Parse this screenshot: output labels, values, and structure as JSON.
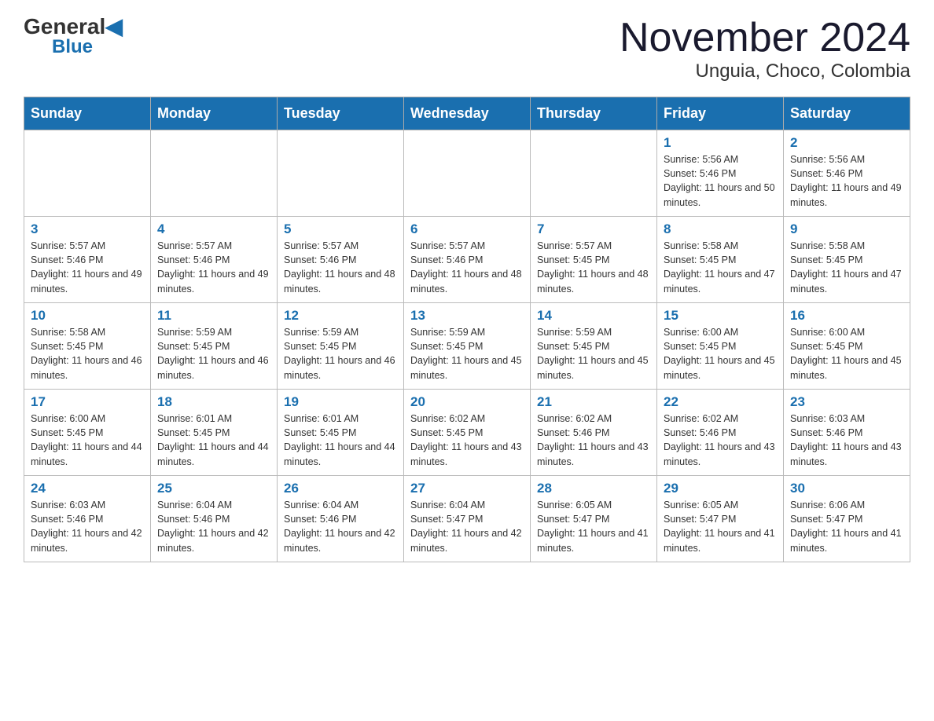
{
  "header": {
    "logo_general": "General",
    "logo_blue": "Blue",
    "month_title": "November 2024",
    "location": "Unguia, Choco, Colombia"
  },
  "weekdays": [
    "Sunday",
    "Monday",
    "Tuesday",
    "Wednesday",
    "Thursday",
    "Friday",
    "Saturday"
  ],
  "weeks": [
    [
      {
        "day": "",
        "sunrise": "",
        "sunset": "",
        "daylight": ""
      },
      {
        "day": "",
        "sunrise": "",
        "sunset": "",
        "daylight": ""
      },
      {
        "day": "",
        "sunrise": "",
        "sunset": "",
        "daylight": ""
      },
      {
        "day": "",
        "sunrise": "",
        "sunset": "",
        "daylight": ""
      },
      {
        "day": "",
        "sunrise": "",
        "sunset": "",
        "daylight": ""
      },
      {
        "day": "1",
        "sunrise": "Sunrise: 5:56 AM",
        "sunset": "Sunset: 5:46 PM",
        "daylight": "Daylight: 11 hours and 50 minutes."
      },
      {
        "day": "2",
        "sunrise": "Sunrise: 5:56 AM",
        "sunset": "Sunset: 5:46 PM",
        "daylight": "Daylight: 11 hours and 49 minutes."
      }
    ],
    [
      {
        "day": "3",
        "sunrise": "Sunrise: 5:57 AM",
        "sunset": "Sunset: 5:46 PM",
        "daylight": "Daylight: 11 hours and 49 minutes."
      },
      {
        "day": "4",
        "sunrise": "Sunrise: 5:57 AM",
        "sunset": "Sunset: 5:46 PM",
        "daylight": "Daylight: 11 hours and 49 minutes."
      },
      {
        "day": "5",
        "sunrise": "Sunrise: 5:57 AM",
        "sunset": "Sunset: 5:46 PM",
        "daylight": "Daylight: 11 hours and 48 minutes."
      },
      {
        "day": "6",
        "sunrise": "Sunrise: 5:57 AM",
        "sunset": "Sunset: 5:46 PM",
        "daylight": "Daylight: 11 hours and 48 minutes."
      },
      {
        "day": "7",
        "sunrise": "Sunrise: 5:57 AM",
        "sunset": "Sunset: 5:45 PM",
        "daylight": "Daylight: 11 hours and 48 minutes."
      },
      {
        "day": "8",
        "sunrise": "Sunrise: 5:58 AM",
        "sunset": "Sunset: 5:45 PM",
        "daylight": "Daylight: 11 hours and 47 minutes."
      },
      {
        "day": "9",
        "sunrise": "Sunrise: 5:58 AM",
        "sunset": "Sunset: 5:45 PM",
        "daylight": "Daylight: 11 hours and 47 minutes."
      }
    ],
    [
      {
        "day": "10",
        "sunrise": "Sunrise: 5:58 AM",
        "sunset": "Sunset: 5:45 PM",
        "daylight": "Daylight: 11 hours and 46 minutes."
      },
      {
        "day": "11",
        "sunrise": "Sunrise: 5:59 AM",
        "sunset": "Sunset: 5:45 PM",
        "daylight": "Daylight: 11 hours and 46 minutes."
      },
      {
        "day": "12",
        "sunrise": "Sunrise: 5:59 AM",
        "sunset": "Sunset: 5:45 PM",
        "daylight": "Daylight: 11 hours and 46 minutes."
      },
      {
        "day": "13",
        "sunrise": "Sunrise: 5:59 AM",
        "sunset": "Sunset: 5:45 PM",
        "daylight": "Daylight: 11 hours and 45 minutes."
      },
      {
        "day": "14",
        "sunrise": "Sunrise: 5:59 AM",
        "sunset": "Sunset: 5:45 PM",
        "daylight": "Daylight: 11 hours and 45 minutes."
      },
      {
        "day": "15",
        "sunrise": "Sunrise: 6:00 AM",
        "sunset": "Sunset: 5:45 PM",
        "daylight": "Daylight: 11 hours and 45 minutes."
      },
      {
        "day": "16",
        "sunrise": "Sunrise: 6:00 AM",
        "sunset": "Sunset: 5:45 PM",
        "daylight": "Daylight: 11 hours and 45 minutes."
      }
    ],
    [
      {
        "day": "17",
        "sunrise": "Sunrise: 6:00 AM",
        "sunset": "Sunset: 5:45 PM",
        "daylight": "Daylight: 11 hours and 44 minutes."
      },
      {
        "day": "18",
        "sunrise": "Sunrise: 6:01 AM",
        "sunset": "Sunset: 5:45 PM",
        "daylight": "Daylight: 11 hours and 44 minutes."
      },
      {
        "day": "19",
        "sunrise": "Sunrise: 6:01 AM",
        "sunset": "Sunset: 5:45 PM",
        "daylight": "Daylight: 11 hours and 44 minutes."
      },
      {
        "day": "20",
        "sunrise": "Sunrise: 6:02 AM",
        "sunset": "Sunset: 5:45 PM",
        "daylight": "Daylight: 11 hours and 43 minutes."
      },
      {
        "day": "21",
        "sunrise": "Sunrise: 6:02 AM",
        "sunset": "Sunset: 5:46 PM",
        "daylight": "Daylight: 11 hours and 43 minutes."
      },
      {
        "day": "22",
        "sunrise": "Sunrise: 6:02 AM",
        "sunset": "Sunset: 5:46 PM",
        "daylight": "Daylight: 11 hours and 43 minutes."
      },
      {
        "day": "23",
        "sunrise": "Sunrise: 6:03 AM",
        "sunset": "Sunset: 5:46 PM",
        "daylight": "Daylight: 11 hours and 43 minutes."
      }
    ],
    [
      {
        "day": "24",
        "sunrise": "Sunrise: 6:03 AM",
        "sunset": "Sunset: 5:46 PM",
        "daylight": "Daylight: 11 hours and 42 minutes."
      },
      {
        "day": "25",
        "sunrise": "Sunrise: 6:04 AM",
        "sunset": "Sunset: 5:46 PM",
        "daylight": "Daylight: 11 hours and 42 minutes."
      },
      {
        "day": "26",
        "sunrise": "Sunrise: 6:04 AM",
        "sunset": "Sunset: 5:46 PM",
        "daylight": "Daylight: 11 hours and 42 minutes."
      },
      {
        "day": "27",
        "sunrise": "Sunrise: 6:04 AM",
        "sunset": "Sunset: 5:47 PM",
        "daylight": "Daylight: 11 hours and 42 minutes."
      },
      {
        "day": "28",
        "sunrise": "Sunrise: 6:05 AM",
        "sunset": "Sunset: 5:47 PM",
        "daylight": "Daylight: 11 hours and 41 minutes."
      },
      {
        "day": "29",
        "sunrise": "Sunrise: 6:05 AM",
        "sunset": "Sunset: 5:47 PM",
        "daylight": "Daylight: 11 hours and 41 minutes."
      },
      {
        "day": "30",
        "sunrise": "Sunrise: 6:06 AM",
        "sunset": "Sunset: 5:47 PM",
        "daylight": "Daylight: 11 hours and 41 minutes."
      }
    ]
  ]
}
